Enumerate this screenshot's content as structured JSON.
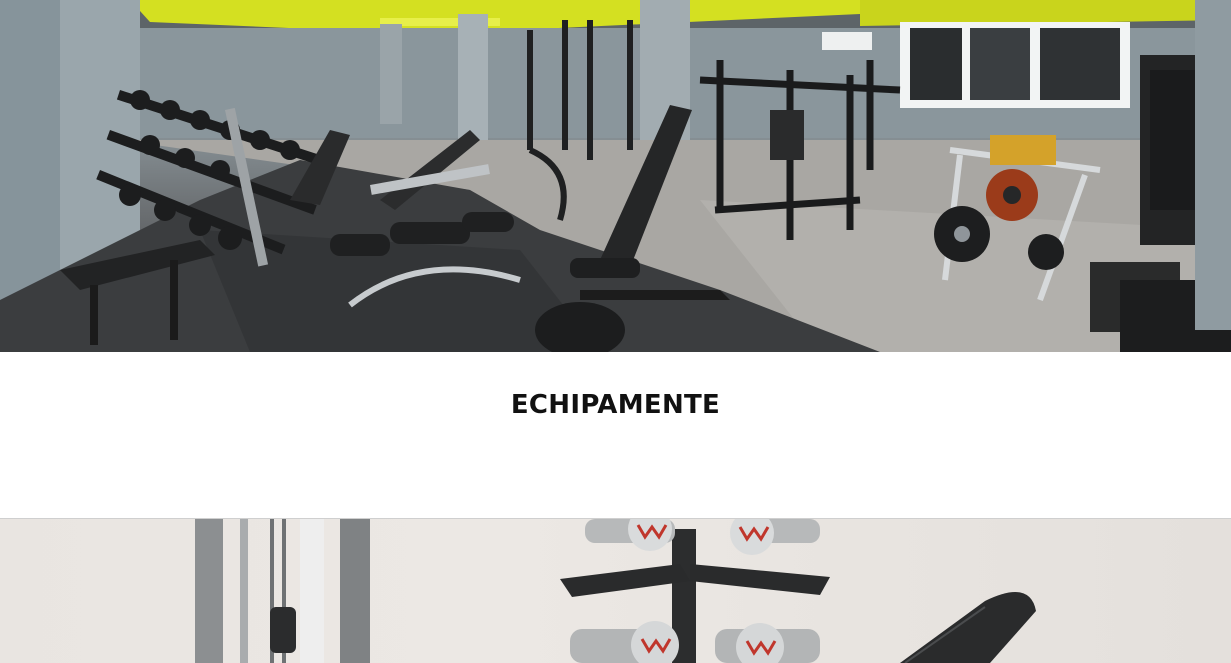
{
  "section": {
    "title": "ECHIPAMENTE"
  },
  "images": {
    "hero": "gym-floor-photo",
    "secondary": "dumbbell-rack-photo"
  },
  "colors": {
    "accent_ceiling": "#d4e021",
    "floor_rubber": "#3b3d3f",
    "floor_wood": "#a9a7a3",
    "wall": "#7f8b91"
  }
}
